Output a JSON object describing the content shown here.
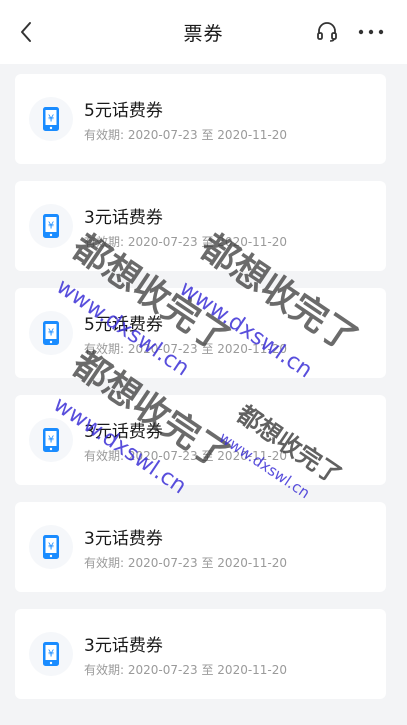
{
  "header": {
    "title": "票券",
    "back_icon": "chevron-left-icon",
    "support_icon": "headset-icon",
    "more_icon": "more-horizontal-icon"
  },
  "tickets": [
    {
      "name": "5元话费券",
      "validity_label": "有效期:",
      "start": "2020-07-23",
      "sep": "至",
      "end": "2020-11-20"
    },
    {
      "name": "3元话费券",
      "validity_label": "有效期:",
      "start": "2020-07-23",
      "sep": "至",
      "end": "2020-11-20"
    },
    {
      "name": "5元话费券",
      "validity_label": "有效期:",
      "start": "2020-07-23",
      "sep": "至",
      "end": "2020-11-20"
    },
    {
      "name": "3元话费券",
      "validity_label": "有效期:",
      "start": "2020-07-23",
      "sep": "至",
      "end": "2020-11-20"
    },
    {
      "name": "3元话费券",
      "validity_label": "有效期:",
      "start": "2020-07-23",
      "sep": "至",
      "end": "2020-11-20"
    },
    {
      "name": "3元话费券",
      "validity_label": "有效期:",
      "start": "2020-07-23",
      "sep": "至",
      "end": "2020-11-20"
    }
  ],
  "watermark": {
    "text_cn": "都想收完了",
    "text_url": "www.dxswl.cn"
  },
  "colors": {
    "icon_blue": "#1a8cff",
    "background": "#f3f4f6"
  }
}
